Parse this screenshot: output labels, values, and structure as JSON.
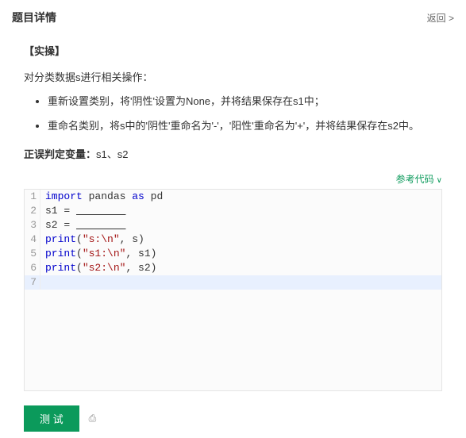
{
  "header": {
    "title": "题目详情",
    "back": "返回 >"
  },
  "section": {
    "label": "【实操】",
    "description": "对分类数据s进行相关操作：",
    "bullets": [
      "重新设置类别，将'阴性'设置为None，并将结果保存在s1中；",
      "重命名类别，将s中的'阴性'重命名为'-'，'阳性'重命名为'+'，并将结果保存在s2中。"
    ],
    "verdict_label": "正误判定变量：",
    "verdict_value": "s1、s2"
  },
  "ref_code": {
    "label": "参考代码",
    "chev": "∨"
  },
  "code": {
    "lines": [
      {
        "n": "1",
        "segs": [
          {
            "t": "import",
            "c": "kw"
          },
          {
            "t": " pandas ",
            "c": "id"
          },
          {
            "t": "as",
            "c": "kw"
          },
          {
            "t": " pd",
            "c": "id"
          }
        ]
      },
      {
        "n": "2",
        "segs": [
          {
            "t": "s1 = ",
            "c": "id"
          },
          {
            "t": "________",
            "c": "id",
            "u": true
          }
        ]
      },
      {
        "n": "3",
        "segs": [
          {
            "t": "s2 = ",
            "c": "id"
          },
          {
            "t": "________",
            "c": "id",
            "u": true
          }
        ]
      },
      {
        "n": "4",
        "segs": [
          {
            "t": "print",
            "c": "kw"
          },
          {
            "t": "(",
            "c": "id"
          },
          {
            "t": "\"s:\\n\"",
            "c": "str"
          },
          {
            "t": ", s)",
            "c": "id"
          }
        ]
      },
      {
        "n": "5",
        "segs": [
          {
            "t": "print",
            "c": "kw"
          },
          {
            "t": "(",
            "c": "id"
          },
          {
            "t": "\"s1:\\n\"",
            "c": "str"
          },
          {
            "t": ", s1)",
            "c": "id"
          }
        ]
      },
      {
        "n": "6",
        "segs": [
          {
            "t": "print",
            "c": "kw"
          },
          {
            "t": "(",
            "c": "id"
          },
          {
            "t": "\"s2:\\n\"",
            "c": "str"
          },
          {
            "t": ", s2)",
            "c": "id"
          }
        ]
      },
      {
        "n": "7",
        "segs": [],
        "active": true
      }
    ]
  },
  "footer": {
    "test_btn": "测 试",
    "icon": "⎙"
  }
}
